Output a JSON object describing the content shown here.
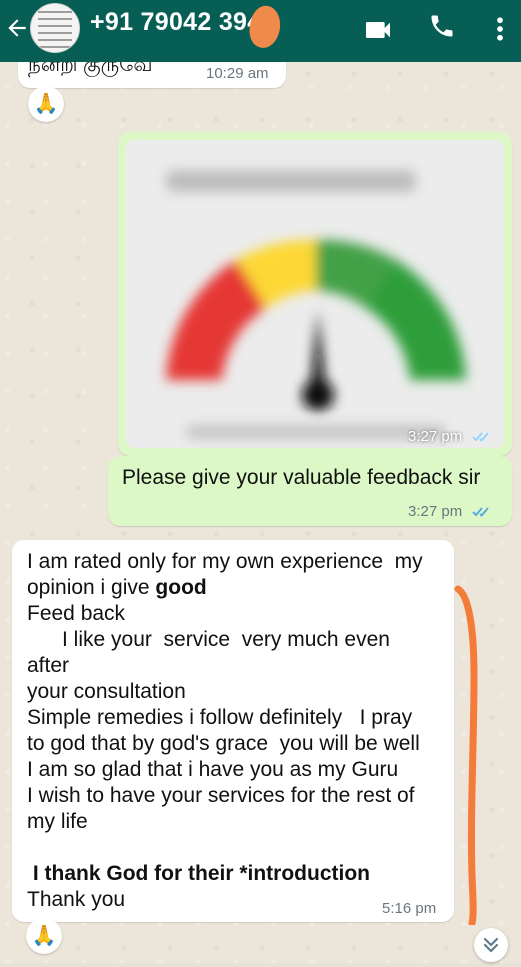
{
  "header": {
    "contact": "+91 79042 394",
    "icons": [
      "back-arrow-icon",
      "video-call-icon",
      "phone-icon",
      "more-vertical-icon"
    ],
    "color": "#075e54"
  },
  "messages": {
    "tamil_bubble": {
      "text": "நன்றி குருவே",
      "time": "10:29 am"
    },
    "reaction_1": "🙏",
    "image_message": {
      "time": "3:27 pm",
      "gauge_colors": [
        "#e53935",
        "#fdd835",
        "#43a047"
      ]
    },
    "feedback_request": {
      "text": "Please give your valuable feedback sir",
      "time": "3:27 pm"
    },
    "reply": {
      "lines": [
        "I am rated only for my own experience  my",
        "opinion i give ",
        "Feed back",
        "      I like your  service  very much even",
        "after",
        "your consultation",
        "Simple remedies i follow definitely   I pray",
        "to god that by god's grace  you will be well",
        "I am so glad that i have you as my Guru",
        "I wish to have your services for the rest of",
        "my life",
        "",
        " I thank God for their *introduction",
        "Thank you"
      ],
      "bold_word": "good",
      "time": "5:16 pm"
    },
    "reaction_2": "🙏"
  },
  "colors": {
    "incoming": "#ffffff",
    "outgoing": "#dcf8c6",
    "read_ticks": "#4fc3f7",
    "annotation": "#f37c3b"
  }
}
